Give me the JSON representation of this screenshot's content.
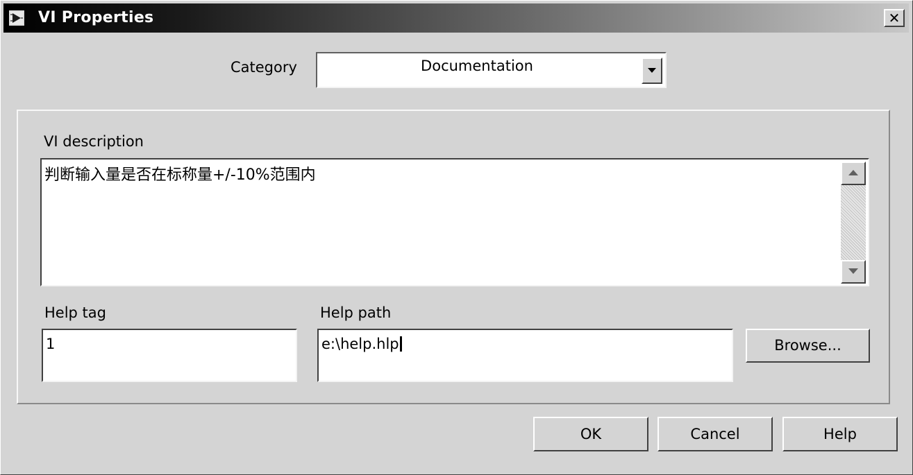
{
  "window": {
    "title": "VI Properties",
    "close_glyph": "✕"
  },
  "category": {
    "label": "Category",
    "value": "Documentation"
  },
  "description": {
    "label": "VI description",
    "text": "判断输入量是否在标称量+/-10%范围内"
  },
  "help_tag": {
    "label": "Help tag",
    "value": "1"
  },
  "help_path": {
    "label": "Help path",
    "value": "e:\\help.hlp"
  },
  "buttons": {
    "browse": "Browse...",
    "ok": "OK",
    "cancel": "Cancel",
    "help": "Help"
  },
  "icons": {
    "app": "labview-vi-icon",
    "close": "close-icon",
    "dropdown": "chevron-down-icon",
    "scroll_up": "arrow-up-icon",
    "scroll_down": "arrow-down-icon"
  }
}
